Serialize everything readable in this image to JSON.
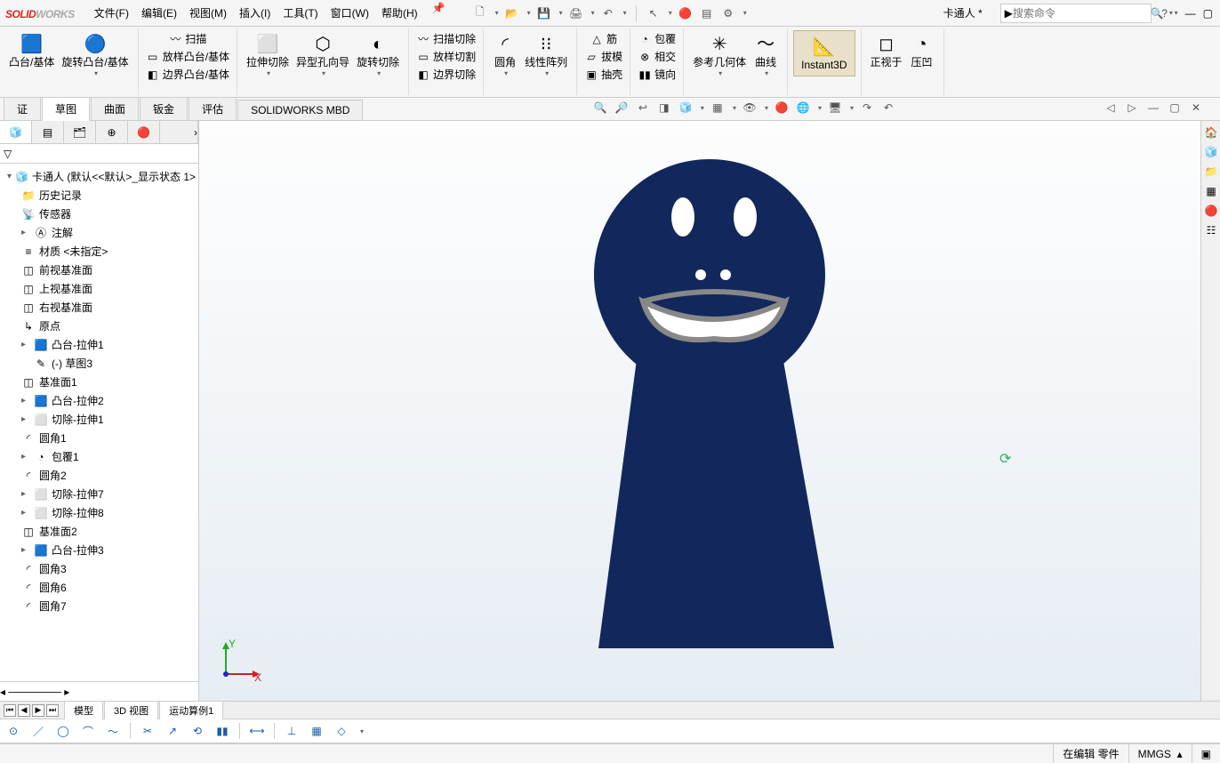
{
  "app": {
    "logo1": "SOLID",
    "logo2": "WORKS",
    "doc_title": "卡通人 *"
  },
  "menu": {
    "file": "文件(F)",
    "edit": "编辑(E)",
    "view": "视图(M)",
    "insert": "插入(I)",
    "tools": "工具(T)",
    "window": "窗口(W)",
    "help": "帮助(H)"
  },
  "search": {
    "placeholder": "搜索命令"
  },
  "ribbon": {
    "g1a": "凸台/基体",
    "g1b": "旋转凸台/基体",
    "scan": "扫描",
    "loft": "放样凸台/基体",
    "boundary": "边界凸台/基体",
    "extcut": "拉伸切除",
    "holewiz": "异型孔向导",
    "revcut": "旋转切除",
    "scancut": "扫描切除",
    "loftcut": "放样切割",
    "boundcut": "边界切除",
    "fillet": "圆角",
    "linpat": "线性阵列",
    "rib": "筋",
    "draft": "拔模",
    "shell": "抽壳",
    "wrap": "包覆",
    "intersect": "相交",
    "mirror": "镜向",
    "refgeom": "参考几何体",
    "curves": "曲线",
    "instant3d": "Instant3D",
    "normalto": "正视于",
    "emboss": "压凹"
  },
  "cmdtabs": {
    "t0": "证",
    "t1": "草图",
    "t2": "曲面",
    "t3": "钣金",
    "t4": "评估",
    "t5": "SOLIDWORKS MBD"
  },
  "fm": {
    "root": "卡通人  (默认<<默认>_显示状态 1>",
    "history": "历史记录",
    "sensors": "传感器",
    "annotations": "注解",
    "material": "材质 <未指定>",
    "front": "前视基准面",
    "top": "上视基准面",
    "right": "右视基准面",
    "origin": "原点",
    "f_boss1": "凸台-拉伸1",
    "f_sketch3": "(-) 草图3",
    "f_plane1": "基准面1",
    "f_boss2": "凸台-拉伸2",
    "f_cut1": "切除-拉伸1",
    "f_fil1": "圆角1",
    "f_wrap1": "包覆1",
    "f_fil2": "圆角2",
    "f_cut7": "切除-拉伸7",
    "f_cut8": "切除-拉伸8",
    "f_plane2": "基准面2",
    "f_boss3": "凸台-拉伸3",
    "f_fil3": "圆角3",
    "f_fil6": "圆角6",
    "f_fil7": "圆角7"
  },
  "btmtabs": {
    "model": "模型",
    "view3d": "3D 视图",
    "motion": "运动算例1"
  },
  "status": {
    "editing": "在编辑 零件",
    "units": "MMGS"
  }
}
